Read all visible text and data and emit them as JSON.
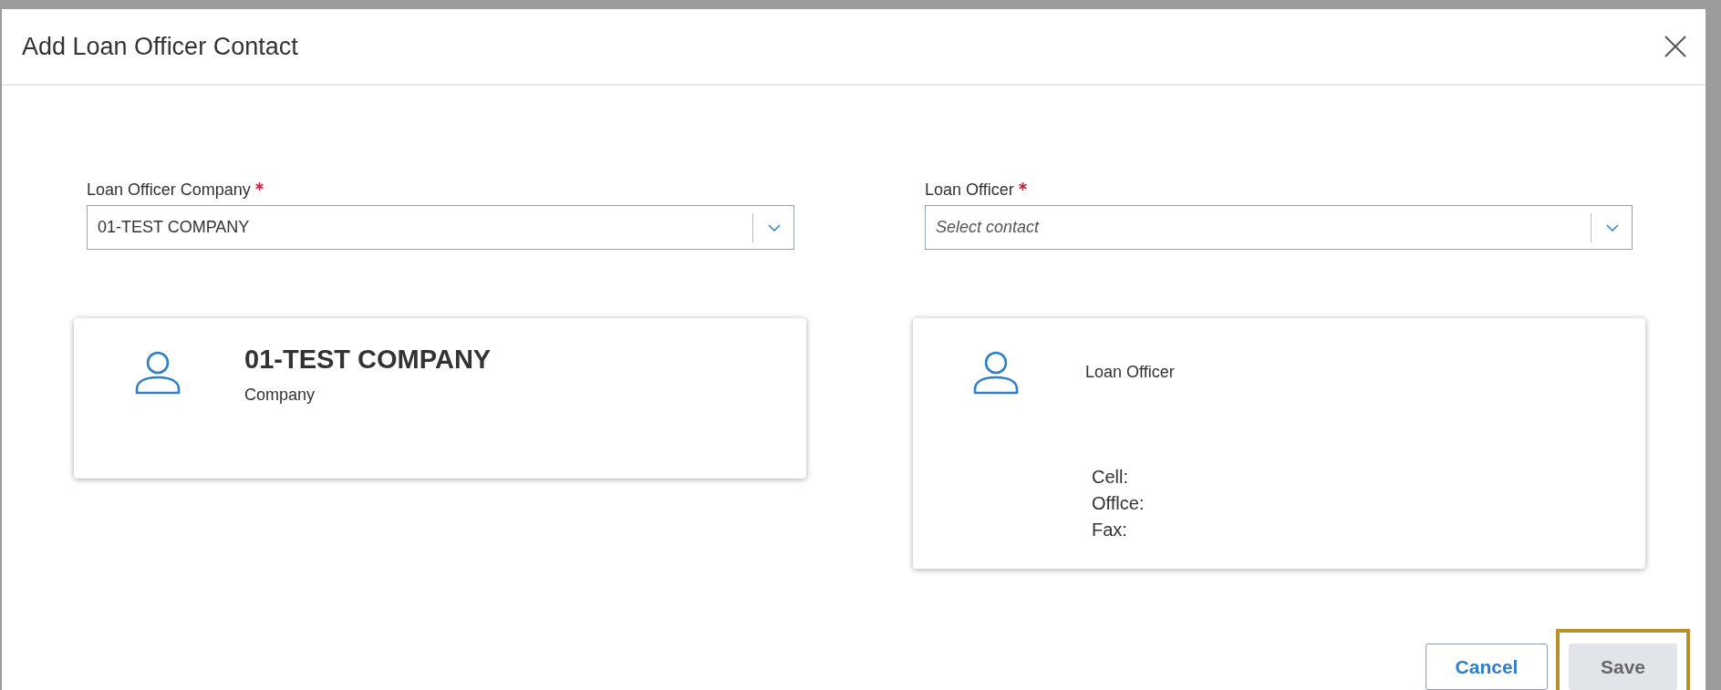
{
  "dialog": {
    "title": "Add Loan Officer Contact"
  },
  "fields": [
    {
      "label": "Loan Officer Company",
      "required": true,
      "value": "01-TEST COMPANY"
    },
    {
      "label": "Loan Officer",
      "required": true,
      "placeholder": "Select contact"
    }
  ],
  "cards": [
    {
      "kind": "company",
      "name": "01-TEST COMPANY",
      "subtitle": "Company"
    },
    {
      "kind": "contact",
      "subtitle": "Loan Officer",
      "details": [
        "Cell:",
        "Offlce:",
        "Fax:"
      ]
    }
  ],
  "buttons": [
    {
      "label": "Cancel",
      "kind": "secondary",
      "disabled": false,
      "highlighted": false
    },
    {
      "label": "Save",
      "kind": "primary",
      "disabled": true,
      "highlighted": true
    }
  ]
}
